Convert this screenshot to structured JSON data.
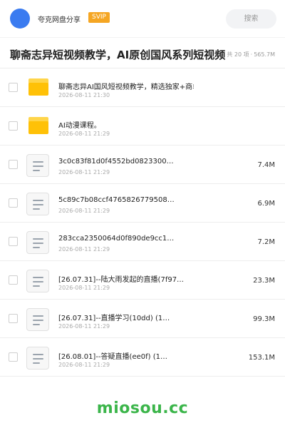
{
  "header": {
    "brand": "夸克网盘分享",
    "badge": "SVIP",
    "search_label": "搜索",
    "accent_color": "#3a7bf0"
  },
  "share": {
    "title": "聊斋志异短视频教学，AI原创国风系列短视频",
    "count": "共 20 项",
    "separator": "·",
    "total_size": "565.7M"
  },
  "items": [
    {
      "type": "folder",
      "name": "聊斋志异AI国风短视频教学，精选独家+商单变现",
      "time": "2026-08-11 21:30",
      "size": ""
    },
    {
      "type": "folder",
      "name": "AI动漫课程。",
      "time": "2026-08-11 21:29",
      "size": ""
    },
    {
      "type": "file",
      "name": "3c0c83f81d0f4552bd0823300…",
      "time": "2026-08-11 21:29",
      "size": "7.4M"
    },
    {
      "type": "file",
      "name": "5c89c7b08ccf4765826779508…",
      "time": "2026-08-11 21:29",
      "size": "6.9M"
    },
    {
      "type": "file",
      "name": "283cca2350064d0f890de9cc1…",
      "time": "2026-08-11 21:29",
      "size": "7.2M"
    },
    {
      "type": "file",
      "name": "[26.07.31]--陆大雨发起的直播(7f97…",
      "time": "2026-08-11 21:29",
      "size": "23.3M"
    },
    {
      "type": "file",
      "name": "[26.07.31]--直播学习(10dd) (1…",
      "time": "2026-08-11 21:29",
      "size": "99.3M"
    },
    {
      "type": "file",
      "name": "[26.08.01]--答疑直播(ee0f) (1…",
      "time": "2026-08-11 21:29",
      "size": "153.1M"
    }
  ],
  "footer": {
    "watermark": "miosou.cc"
  }
}
